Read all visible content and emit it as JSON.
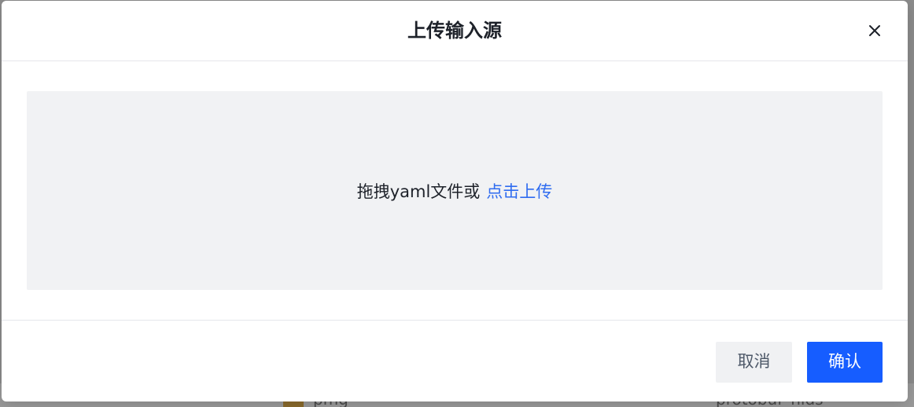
{
  "background": {
    "row_texts": [
      "pmg",
      "protobuf_nlds"
    ]
  },
  "dialog": {
    "title": "上传输入源",
    "close_icon": "close-icon",
    "dropzone": {
      "text": "拖拽yaml文件或",
      "link_text": "点击上传"
    },
    "footer": {
      "cancel_label": "取消",
      "confirm_label": "确认"
    }
  },
  "colors": {
    "primary": "#165dff",
    "link": "#2f6cf0",
    "dropzone_bg": "#f1f2f4",
    "cancel_bg": "#f0f1f3"
  }
}
